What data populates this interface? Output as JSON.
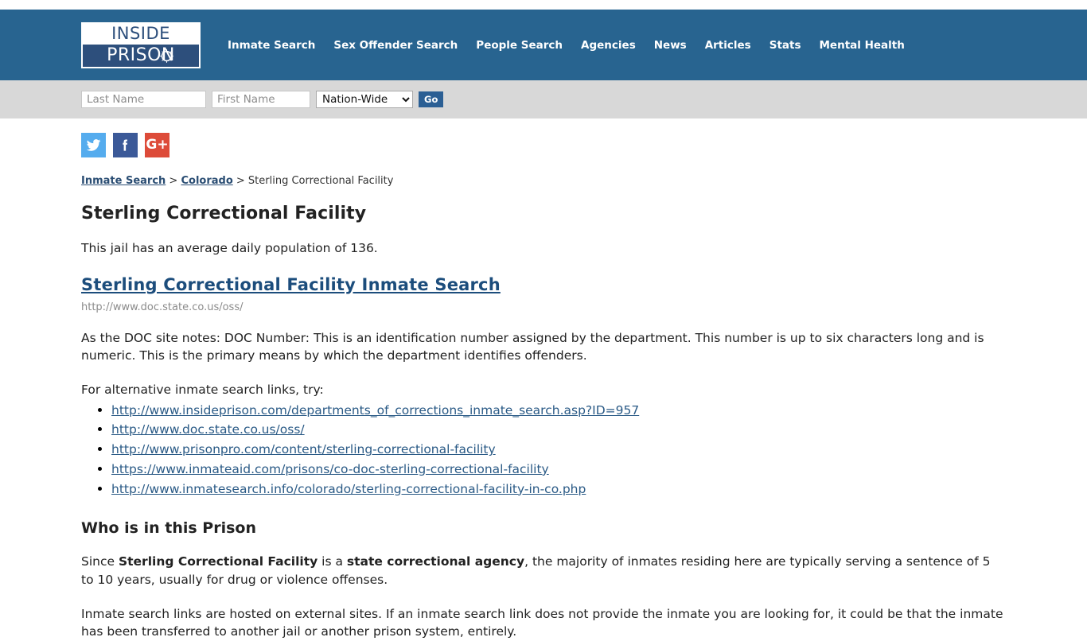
{
  "header": {
    "logo": {
      "line1": "INSIDE",
      "line2": "PRISON",
      "icon": "barbed-wire-circle-icon"
    },
    "nav": [
      {
        "label": "Inmate Search"
      },
      {
        "label": "Sex Offender Search"
      },
      {
        "label": "People Search"
      },
      {
        "label": "Agencies"
      },
      {
        "label": "News"
      },
      {
        "label": "Articles"
      },
      {
        "label": "Stats"
      },
      {
        "label": "Mental Health"
      }
    ],
    "brand_color": "#286490"
  },
  "search": {
    "last_name_placeholder": "Last Name",
    "last_name_value": "",
    "first_name_placeholder": "First Name",
    "first_name_value": "",
    "scope_selected": "Nation-Wide",
    "scope_options": [
      "Nation-Wide"
    ],
    "go_label": "Go",
    "go_color": "#2b5f94",
    "bar_color": "#d8d8d8"
  },
  "social": [
    {
      "name": "twitter",
      "color": "#55acee",
      "glyph": "twitter-icon"
    },
    {
      "name": "facebook",
      "color": "#3b5998",
      "glyph": "facebook-icon",
      "letter": "f"
    },
    {
      "name": "googleplus",
      "color": "#dd4b39",
      "glyph": "google-plus-icon",
      "letter": "G+"
    }
  ],
  "breadcrumb": {
    "item1": "Inmate Search",
    "sep1": " > ",
    "item2": "Colorado",
    "sep2": " > ",
    "current": "Sterling Correctional Facility"
  },
  "main": {
    "page_title": "Sterling Correctional Facility",
    "population_text": "This jail has an average daily population of 136.",
    "primary_link_label": "Sterling Correctional Facility Inmate Search",
    "primary_link_url": "http://www.doc.state.co.us/oss/",
    "doc_note": "As the DOC site notes: DOC Number: This is an identification number assigned by the department. This number is up to six characters long and is numeric. This is the primary means by which the department identifies offenders.",
    "alt_links_intro": "For alternative inmate search links, try:",
    "alt_links": [
      "http://www.insideprison.com/departments_of_corrections_inmate_search.asp?ID=957",
      "http://www.doc.state.co.us/oss/",
      "http://www.prisonpro.com/content/sterling-correctional-facility",
      "https://www.inmateaid.com/prisons/co-doc-sterling-correctional-facility",
      "http://www.inmatesearch.info/colorado/sterling-correctional-facility-in-co.php"
    ],
    "section_title": "Who is in this Prison",
    "who_part1": "Since ",
    "who_bold1": "Sterling Correctional Facility",
    "who_part2": " is a ",
    "who_bold2": "state correctional agency",
    "who_part3": ", the majority of inmates residing here are typically serving a sentence of 5 to 10 years, usually for drug or violence offenses.",
    "closing_text": "Inmate search links are hosted on external sites. If an inmate search link does not provide the inmate you are looking for, it could be that the inmate has been transferred to another jail or another prison system, entirely."
  }
}
